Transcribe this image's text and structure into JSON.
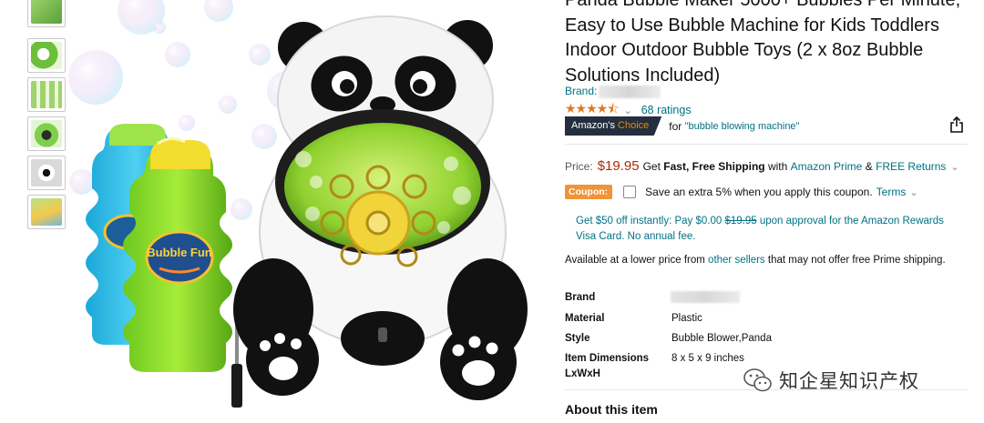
{
  "thumbnails": [
    {
      "name": "thumbnail-1"
    },
    {
      "name": "thumbnail-2"
    },
    {
      "name": "thumbnail-3"
    },
    {
      "name": "thumbnail-4"
    },
    {
      "name": "thumbnail-5"
    },
    {
      "name": "thumbnail-6"
    }
  ],
  "product_image": {
    "bottle_label_text": "Bubble Fun"
  },
  "product": {
    "title": "Panda Bubble Maker 5000+ Bubbles Per Minute, Easy to Use Bubble Machine for Kids Toddlers Indoor Outdoor Bubble Toys (2 x 8oz Bubble Solutions Included)",
    "brand_label": "Brand:",
    "rating_count": "68 ratings",
    "choice_badge_prefix": "Amazon's",
    "choice_badge_suffix": "Choice",
    "choice_for": "for",
    "choice_keyword": "\"bubble blowing machine\""
  },
  "pricing": {
    "label": "Price:",
    "price": "$19.95",
    "get": "Get",
    "shipping": "Fast, Free Shipping",
    "with": "with",
    "prime": "Amazon Prime",
    "amp": "&",
    "free_returns": "FREE Returns"
  },
  "coupon": {
    "tag": "Coupon:",
    "text": "Save an extra 5% when you apply this coupon.",
    "terms": "Terms"
  },
  "offer": {
    "part1": "Get $50 off instantly: Pay $0.00",
    "strike": "$19.95",
    "part2": "upon approval for the Amazon Rewards Visa Card. No annual fee."
  },
  "availability": {
    "part1": "Available at a lower price from",
    "link": "other sellers",
    "part2": "that may not offer free Prime shipping."
  },
  "specs": [
    {
      "key": "Brand",
      "value": ""
    },
    {
      "key": "Material",
      "value": "Plastic"
    },
    {
      "key": "Style",
      "value": "Bubble Blower,Panda"
    },
    {
      "key": "Item Dimensions LxWxH",
      "value": "8 x 5 x 9 inches"
    }
  ],
  "about_heading": "About this item",
  "watermark": "知企星知识产权",
  "colors": {
    "link": "#007185",
    "price": "#b12704",
    "star": "#de7921",
    "badge": "#232f3e",
    "coupon": "#f09437"
  },
  "rating": {
    "stars": 4.5,
    "max": 5
  }
}
